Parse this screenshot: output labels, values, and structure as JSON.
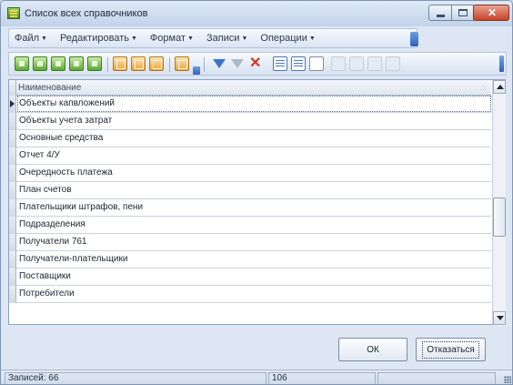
{
  "window": {
    "title": "Список всех справочников",
    "icon": "table-icon"
  },
  "menu": [
    {
      "label": "Файл"
    },
    {
      "label": "Редактировать"
    },
    {
      "label": "Формат"
    },
    {
      "label": "Записи"
    },
    {
      "label": "Операции"
    }
  ],
  "grid": {
    "column_header": "Наименование",
    "rows": [
      "Объекты капвложений",
      "Объекты учета затрат",
      "Основные средства",
      "Отчет 4/У",
      "Очередность платежа",
      "План счетов",
      "Плательщики штрафов, пени",
      "Подразделения",
      "Получатели 761",
      "Получатели-плательщики",
      "Поставщики",
      "Потребители"
    ],
    "selected_index": 0
  },
  "buttons": {
    "ok": "ОК",
    "cancel": "Отказаться"
  },
  "status": {
    "records": "Записей: 66",
    "position": "106",
    "extra": ""
  }
}
